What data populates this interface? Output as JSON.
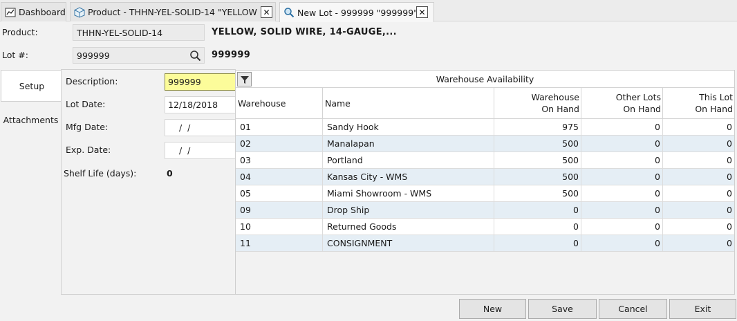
{
  "tabs": [
    {
      "label": "Dashboard",
      "icon": "chart-icon"
    },
    {
      "label": "Product - THHN-YEL-SOLID-14 \"YELLOW",
      "icon": "box-icon"
    },
    {
      "label": "New Lot - 999999 \"999999\"",
      "icon": "lot-search-icon"
    }
  ],
  "tab_close_glyph": "✕",
  "header": {
    "product_label": "Product:",
    "product_value": "THHN-YEL-SOLID-14",
    "product_desc": "YELLOW, SOLID WIRE, 14-GAUGE,...",
    "lot_label": "Lot #:",
    "lot_value": "999999",
    "lot_desc": "999999"
  },
  "side_tabs": [
    "Setup",
    "Attachments"
  ],
  "form": {
    "description_label": "Description:",
    "description_value": "999999",
    "lot_date_label": "Lot Date:",
    "lot_date_value": "12/18/2018",
    "mfg_date_label": "Mfg Date:",
    "mfg_date_value": "  /  /",
    "exp_date_label": "Exp. Date:",
    "exp_date_value": "  /  /",
    "shelf_life_label": "Shelf Life (days):",
    "shelf_life_value": "0"
  },
  "grid": {
    "title": "Warehouse Availability",
    "columns": {
      "warehouse": "Warehouse",
      "name": "Name",
      "wh_on_hand_1": "Warehouse",
      "wh_on_hand_2": "On Hand",
      "other_lots_1": "Other Lots",
      "other_lots_2": "On Hand",
      "this_lot_1": "This Lot",
      "this_lot_2": "On Hand"
    },
    "rows": [
      {
        "warehouse": "01",
        "name": "Sandy Hook",
        "wh_on_hand": "975",
        "other_lots": "0",
        "this_lot": "0"
      },
      {
        "warehouse": "02",
        "name": "Manalapan",
        "wh_on_hand": "500",
        "other_lots": "0",
        "this_lot": "0"
      },
      {
        "warehouse": "03",
        "name": "Portland",
        "wh_on_hand": "500",
        "other_lots": "0",
        "this_lot": "0"
      },
      {
        "warehouse": "04",
        "name": "Kansas City - WMS",
        "wh_on_hand": "500",
        "other_lots": "0",
        "this_lot": "0"
      },
      {
        "warehouse": "05",
        "name": "Miami Showroom - WMS",
        "wh_on_hand": "500",
        "other_lots": "0",
        "this_lot": "0"
      },
      {
        "warehouse": "09",
        "name": "Drop Ship",
        "wh_on_hand": "0",
        "other_lots": "0",
        "this_lot": "0"
      },
      {
        "warehouse": "10",
        "name": "Returned Goods",
        "wh_on_hand": "0",
        "other_lots": "0",
        "this_lot": "0"
      },
      {
        "warehouse": "11",
        "name": "CONSIGNMENT",
        "wh_on_hand": "0",
        "other_lots": "0",
        "this_lot": "0"
      }
    ]
  },
  "buttons": {
    "new": "New",
    "save": "Save",
    "cancel": "Cancel",
    "exit": "Exit"
  },
  "colors": {
    "focused_field": "#fcfc9a",
    "alt_row": "#e5eef5"
  }
}
